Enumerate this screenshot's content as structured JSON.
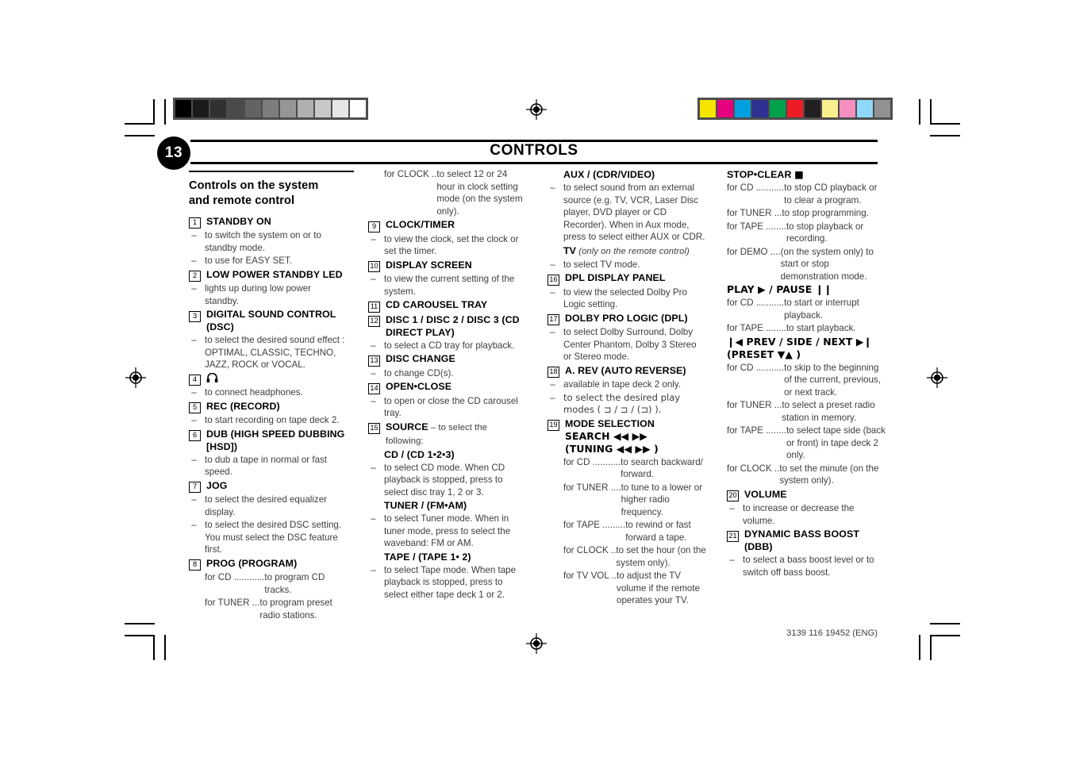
{
  "header": {
    "page_number": "13",
    "title": "CONTROLS"
  },
  "footer": {
    "doc_code": "3139 116 19452 (ENG)"
  },
  "marks": {
    "grayscale_patches": [
      "#000000",
      "#1a1a1a",
      "#303030",
      "#4a4a4a",
      "#636363",
      "#7d7d7d",
      "#969696",
      "#b0b0b0",
      "#c8c8c8",
      "#e6e6e6",
      "#ffffff"
    ],
    "color_patches": [
      "#f5e500",
      "#e5007d",
      "#00a0e0",
      "#2e3192",
      "#00a14b",
      "#ed1c24",
      "#231f20",
      "#faef8d",
      "#f versus",
      "#8ed8f8",
      "#919191"
    ],
    "color_patches_list": [
      "#f5e500",
      "#e5007d",
      "#00a0e0",
      "#2e3192",
      "#00a14b",
      "#ed1c24",
      "#231f20",
      "#faef8d",
      "#f48fc0",
      "#8ed8f8",
      "#919191"
    ],
    "registration_icon": "registration-target-icon"
  },
  "col1": {
    "section_title_line1": "Controls on the system",
    "section_title_line2": "and remote control",
    "entries": [
      {
        "num": "1",
        "title": "STANDBY ON",
        "bullets": [
          "to switch the system on or to standby mode.",
          "to use for EASY SET."
        ]
      },
      {
        "num": "2",
        "title": "LOW POWER STANDBY LED",
        "bullets": [
          "lights up during low power standby."
        ]
      },
      {
        "num": "3",
        "title": "DIGITAL SOUND CONTROL  (DSC)",
        "bullets": [
          "to select the desired sound effect : OPTIMAL, CLASSIC, TECHNO, JAZZ, ROCK or VOCAL."
        ]
      },
      {
        "num": "4",
        "title_icon": "headphone-icon",
        "title": "",
        "bullets": [
          "to connect headphones."
        ]
      },
      {
        "num": "5",
        "title": "REC (RECORD)",
        "bullets": [
          "to start recording on tape deck 2."
        ]
      },
      {
        "num": "6",
        "title": "DUB (HIGH SPEED DUBBING [HSD])",
        "bullets": [
          "to dub a tape in normal or fast speed."
        ]
      },
      {
        "num": "7",
        "title": "JOG",
        "bullets": [
          "to select the desired equalizer display.",
          "to select the desired DSC setting. You must select the DSC feature first."
        ]
      },
      {
        "num": "8",
        "title": "PROG (PROGRAM)",
        "defs": [
          {
            "label": "for CD ............",
            "desc": "to program CD tracks."
          },
          {
            "label": "for TUNER ...",
            "desc": "to program preset radio stations."
          }
        ]
      }
    ]
  },
  "col2": {
    "cont_def": {
      "label": "for CLOCK ..",
      "desc_part1": "to select 12 or 24 hour in clock setting mode ",
      "desc_italic": "(on the system only)",
      "desc_part2": "."
    },
    "entries": [
      {
        "num": "9",
        "title": "CLOCK/TIMER",
        "bullets": [
          "to view the clock, set the clock or set the timer."
        ]
      },
      {
        "num": "10",
        "title": "DISPLAY SCREEN",
        "bullets": [
          "to view the current setting of the system."
        ]
      },
      {
        "num": "11",
        "title": "CD CAROUSEL TRAY",
        "bullets": []
      },
      {
        "num": "12",
        "title": "DISC 1 / DISC 2 / DISC 3 (CD DIRECT PLAY)",
        "bullets": [
          "to select a CD tray for playback."
        ]
      },
      {
        "num": "13",
        "title": "DISC CHANGE",
        "bullets": [
          "to change CD(s)."
        ]
      },
      {
        "num": "14",
        "title": "OPEN•CLOSE",
        "bullets": [
          "to open or close the CD carousel tray."
        ]
      },
      {
        "num": "15",
        "title": "SOURCE",
        "title_suffix": " – to select the following:",
        "subs": [
          {
            "subtitle": "CD / (CD 1•2•3)",
            "bullets": [
              "to select CD mode. When CD playback is stopped, press to select disc tray 1, 2 or 3."
            ]
          },
          {
            "subtitle": "TUNER / (FM•AM)",
            "bullets": [
              "to select Tuner mode. When in tuner mode, press to select the waveband: FM or AM."
            ]
          },
          {
            "subtitle": "TAPE / (TAPE 1• 2)",
            "bullets": [
              "to select Tape mode. When tape playback is stopped, press to select either tape deck 1 or 2."
            ]
          }
        ]
      }
    ]
  },
  "col3": {
    "lead_sub": {
      "subtitle": "AUX / (CDR/VIDEO)",
      "bullets": [
        "to select sound from an external source (e.g. TV, VCR, Laser Disc player, DVD player or CD Recorder). When in Aux mode, press to select either AUX or CDR."
      ]
    },
    "tv_sub": {
      "subtitle": "TV",
      "subtitle_italic": " (only on the remote control)",
      "bullets": [
        "to select TV mode."
      ]
    },
    "entries": [
      {
        "num": "16",
        "title": "DPL DISPLAY PANEL",
        "bullets": [
          "to view the selected Dolby Pro Logic setting."
        ]
      },
      {
        "num": "17",
        "title": "DOLBY PRO LOGIC (DPL)",
        "bullets": [
          "to select Dolby Surround, Dolby Center Phantom, Dolby 3 Stereo or Stereo mode."
        ]
      },
      {
        "num": "18",
        "title": "A. REV (AUTO REVERSE)",
        "bullets": [
          "available in tape deck 2 only.",
          "to select the desired play modes ( ⊐ / ⊐ / (⊐) )."
        ]
      },
      {
        "num": "19",
        "title_line1": "MODE SELECTION",
        "title_line2": "SEARCH ◀◀ ▶▶",
        "title_line3": "(TUNING ◀◀ ▶▶  )",
        "defs": [
          {
            "label": "for CD ...........",
            "desc": "to search backward/ forward."
          },
          {
            "label": "for TUNER ....",
            "desc": "to tune to a lower or higher radio frequency."
          },
          {
            "label": "for TAPE .........",
            "desc": "to rewind or fast forward a tape."
          },
          {
            "label": "for CLOCK ..",
            "desc": "to set the hour ",
            "desc_italic": "(on the system only)",
            "desc_tail": "."
          },
          {
            "label": "for TV VOL ..",
            "desc": "to adjust the TV volume if the remote operates your TV."
          }
        ]
      }
    ]
  },
  "col4": {
    "stop_clear": {
      "title": "STOP•CLEAR",
      "title_symbol": "■",
      "defs": [
        {
          "label": "for CD ...........",
          "desc": "to stop CD playback or to clear a program."
        },
        {
          "label": "for TUNER ...",
          "desc": "to stop programming."
        },
        {
          "label": "for TAPE ........",
          "desc": "to stop playback or recording."
        },
        {
          "label": "for DEMO ....",
          "desc_italic": "(on the system only)",
          "desc_tail": " to start or stop demonstration mode."
        }
      ]
    },
    "play_pause": {
      "title": "PLAY  ▶ / PAUSE  ❙❙",
      "defs": [
        {
          "label": "for CD ...........",
          "desc": "to start or interrupt playback."
        },
        {
          "label": "for TAPE ........",
          "desc": "to start playback."
        }
      ]
    },
    "prev_next": {
      "title_line1": "❙◀ PREV / SIDE / NEXT ▶❙",
      "title_line2": "(PRESET ▼▲ )",
      "defs": [
        {
          "label": "for CD ...........",
          "desc": "to skip to the beginning of the current, previous, or next track."
        },
        {
          "label": "for TUNER ...",
          "desc": "to select a preset radio station in memory."
        },
        {
          "label": "for TAPE ........",
          "desc": "to select tape side (back or front) in tape deck 2 only."
        },
        {
          "label": "for CLOCK ..",
          "desc": "to set the minute ",
          "desc_italic": "(on the system only)",
          "desc_tail": "."
        }
      ]
    },
    "entries": [
      {
        "num": "20",
        "title": "VOLUME",
        "bullets": [
          "to increase or decrease the volume."
        ]
      },
      {
        "num": "21",
        "title": "DYNAMIC BASS BOOST (DBB)",
        "bullets": [
          "to select a bass boost level or to switch off bass boost."
        ]
      }
    ]
  }
}
